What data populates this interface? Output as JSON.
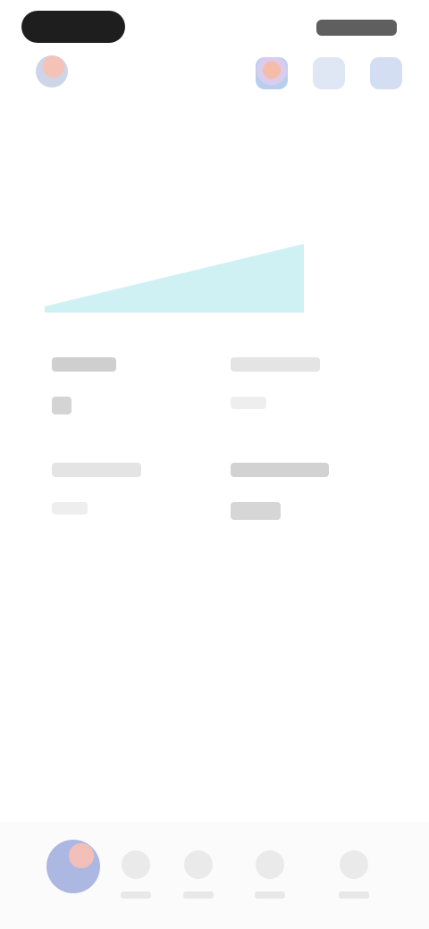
{
  "status_bar": {
    "left_pill": "",
    "right_indicators": ""
  },
  "header": {
    "profile_icon": "avatar-icon",
    "actions": [
      {
        "icon": "gradient-app-icon"
      },
      {
        "icon": "square-icon"
      },
      {
        "icon": "square-icon"
      }
    ]
  },
  "chart_data": {
    "type": "area",
    "x": [
      0,
      1
    ],
    "series": [
      {
        "values": [
          0.05,
          0.55
        ]
      }
    ],
    "x_end_label": "",
    "title": "",
    "xlabel": "",
    "ylabel": "",
    "grid": false,
    "colors": [
      "#c8eef2"
    ]
  },
  "stats": [
    {
      "label": "",
      "value": ""
    },
    {
      "label": "",
      "value": ""
    },
    {
      "label": "",
      "value": ""
    },
    {
      "label": "",
      "value": ""
    }
  ],
  "bottom_nav": {
    "items": [
      {
        "label": "",
        "icon": "app-icon"
      },
      {
        "label": "",
        "icon": "nav-icon"
      },
      {
        "label": "",
        "icon": "nav-icon"
      },
      {
        "label": "",
        "icon": "nav-icon"
      },
      {
        "label": "",
        "icon": "nav-icon"
      }
    ]
  },
  "colors": {
    "background": "#ffffff",
    "chart_fill": "#c8eef2",
    "status_pill": "#1e1e1e"
  }
}
